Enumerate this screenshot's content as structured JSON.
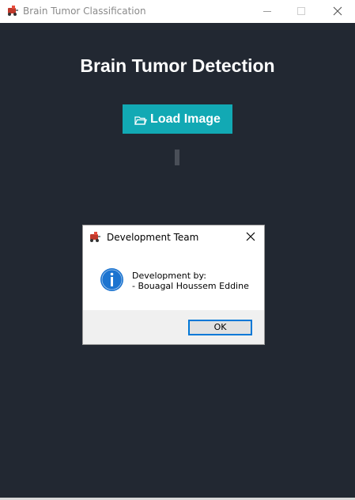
{
  "window": {
    "title": "Brain Tumor Classification",
    "icon": "app-logo-icon"
  },
  "main": {
    "heading": "Brain Tumor Detection",
    "load_button": {
      "label": "Load Image",
      "icon": "folder-open-icon"
    }
  },
  "dialog": {
    "title": "Development Team",
    "message_lines": [
      "Development by:",
      "- Bouagal Houssem Eddine"
    ],
    "icon": "info-icon",
    "ok_label": "OK"
  },
  "colors": {
    "background": "#222832",
    "accent_button": "#12a9b4",
    "ok_border": "#0078d7",
    "info_blue": "#1c74d0"
  }
}
